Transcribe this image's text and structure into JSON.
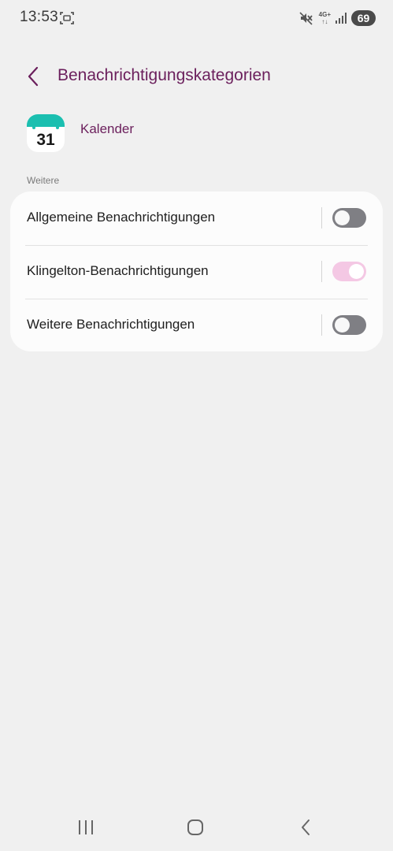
{
  "status_bar": {
    "time": "13:53",
    "network_type": "4G+",
    "battery_level": "69",
    "icons": [
      "screenshot-icon",
      "mute-icon",
      "signal-icon"
    ]
  },
  "header": {
    "title": "Benachrichtigungskategorien",
    "back_icon": "chevron-left-icon"
  },
  "app": {
    "name": "Kalender",
    "icon_day": "31",
    "icon_color": "#1bbfb0"
  },
  "section": {
    "label": "Weitere"
  },
  "settings": {
    "items": [
      {
        "label": "Allgemeine Benachrichtigungen",
        "enabled": false
      },
      {
        "label": "Klingelton-Benachrichtigungen",
        "enabled": true
      },
      {
        "label": "Weitere Benachrichtigungen",
        "enabled": false
      }
    ]
  },
  "nav_bar": {
    "buttons": [
      "recent-apps-icon",
      "home-icon",
      "back-icon"
    ]
  },
  "colors": {
    "accent": "#6b1f5c",
    "background": "#f0f0f0",
    "card": "#fcfcfc",
    "toggle_off": "#7f7f84",
    "toggle_on": "#f4c8e4"
  }
}
